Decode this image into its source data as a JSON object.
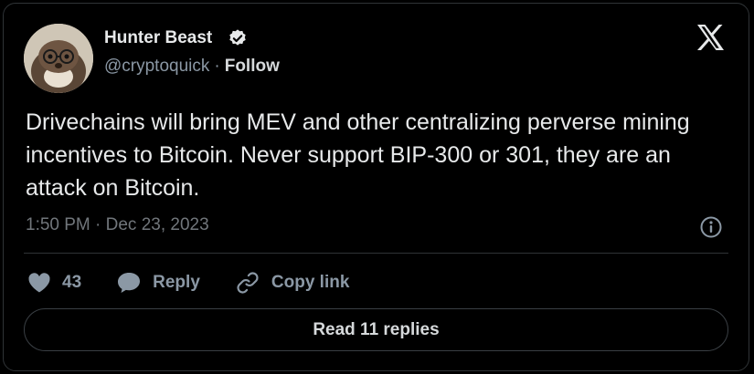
{
  "author": {
    "name": "Hunter Beast",
    "name_emoji": "🕯",
    "verified_icon": "verified-badge-icon",
    "handle": "@cryptoquick",
    "separator": "·",
    "follow_label": "Follow"
  },
  "tweet": {
    "text": "Drivechains will bring MEV and other centralizing perverse mining incentives to Bitcoin. Never support BIP-300 or 301, they are an attack on Bitcoin.",
    "timestamp": "1:50 PM · Dec 23, 2023"
  },
  "actions": {
    "like_count": "43",
    "reply_label": "Reply",
    "copy_label": "Copy link"
  },
  "read_replies_label": "Read 11 replies",
  "icons": {
    "logo": "x-logo-icon",
    "info": "info-icon",
    "like": "heart-icon",
    "reply": "reply-bubble-icon",
    "copy": "link-icon"
  },
  "colors": {
    "background": "#000000",
    "text_primary": "#e7e9ea",
    "text_secondary": "#8b98a5",
    "border": "#2f3336"
  }
}
